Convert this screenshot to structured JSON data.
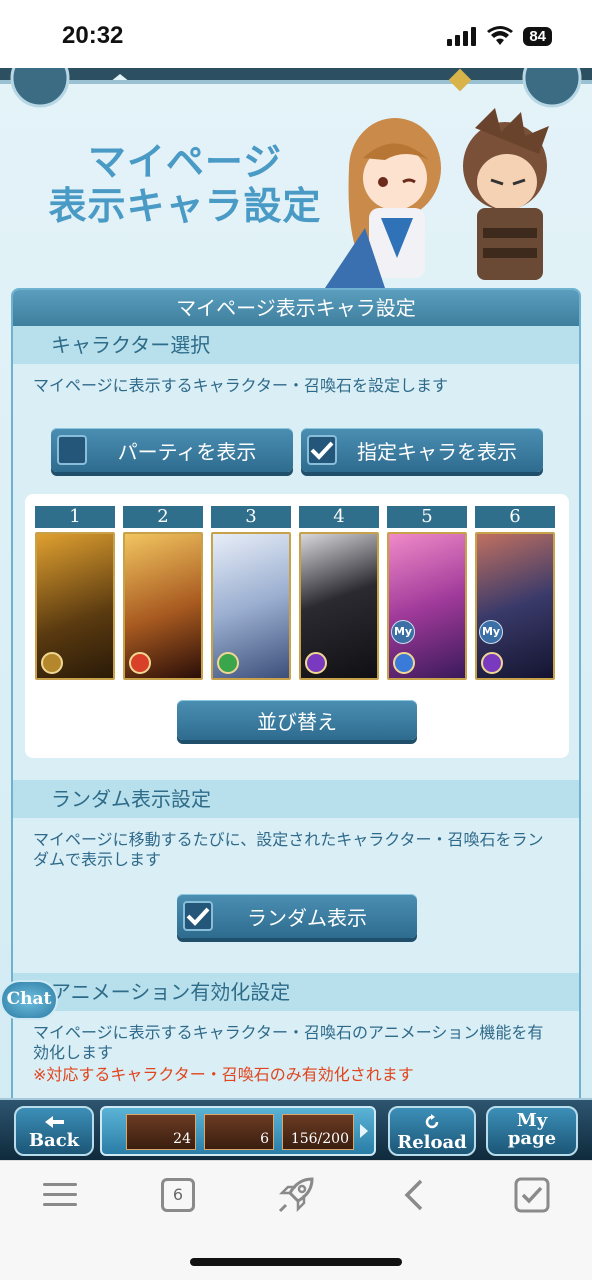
{
  "status": {
    "time": "20:32",
    "battery": "84"
  },
  "title": {
    "line1": "マイページ",
    "line2": "表示キャラ設定"
  },
  "panel": {
    "header": "マイページ表示キャラ設定",
    "char_select": {
      "heading": "キャラクター選択",
      "desc": "マイページに表示するキャラクター・召喚石を設定します",
      "option_party": "パーティを表示",
      "option_chara": "指定キャラを表示",
      "slots": [
        "1",
        "2",
        "3",
        "4",
        "5",
        "6"
      ],
      "sort_button": "並び替え"
    },
    "random": {
      "heading": "ランダム表示設定",
      "desc": "マイページに移動するたびに、設定されたキャラクター・召喚石をランダムで表示します",
      "toggle_label": "ランダム表示"
    },
    "animation": {
      "heading": "アニメーション有効化設定",
      "desc": "マイページに表示するキャラクター・召喚石のアニメーション機能を有効化します",
      "note": "※対応するキャラクター・召喚石のみ有効化されます"
    }
  },
  "chat": "Chat",
  "my_badge": "My",
  "game_nav": {
    "back": "Back",
    "res1": "24",
    "res2": "6",
    "res3": "156/200",
    "reload": "Reload",
    "my": "My",
    "page": "page"
  },
  "browser": {
    "tabs_count": "6"
  }
}
